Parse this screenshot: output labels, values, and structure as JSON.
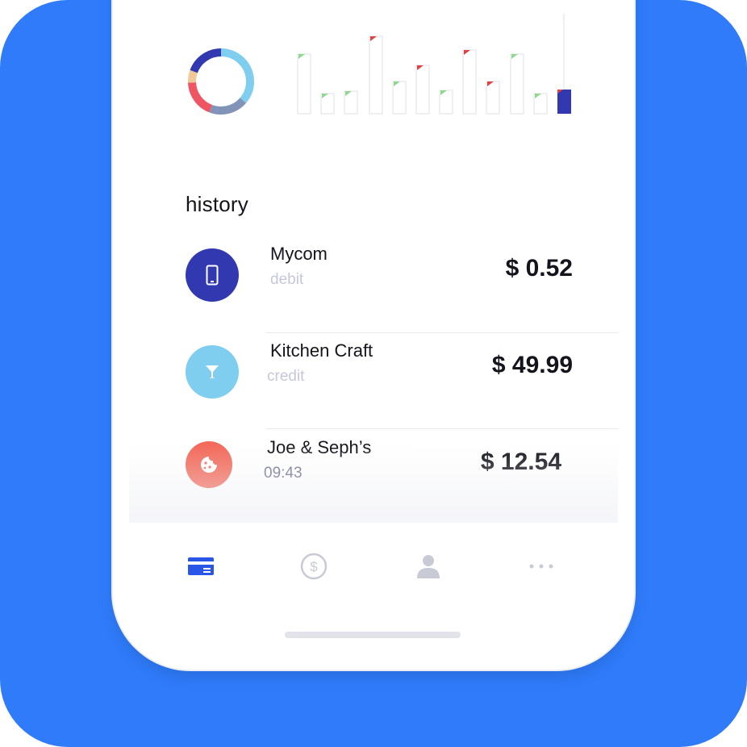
{
  "section_title": "history",
  "colors": {
    "background": "#2f7bfa",
    "accent_blue": "#3238b0",
    "light_blue": "#7fcef0",
    "coral": "#f26a5a",
    "muted_text": "#c5c8dc"
  },
  "transactions": [
    {
      "name": "Mycom",
      "sub": "debit",
      "amount": "$ 0.52",
      "icon": "phone-icon"
    },
    {
      "name": "Kitchen Craft",
      "sub": "credit",
      "amount": "$ 49.99",
      "icon": "cocktail-icon"
    },
    {
      "name": "Joe & Seph’s",
      "sub": "09:43",
      "amount": "$ 12.54",
      "icon": "cookie-icon"
    }
  ],
  "tabs": [
    {
      "icon": "card-icon",
      "active": true
    },
    {
      "icon": "dollar-icon",
      "active": false
    },
    {
      "icon": "profile-icon",
      "active": false
    },
    {
      "icon": "more-icon",
      "active": false
    }
  ]
}
